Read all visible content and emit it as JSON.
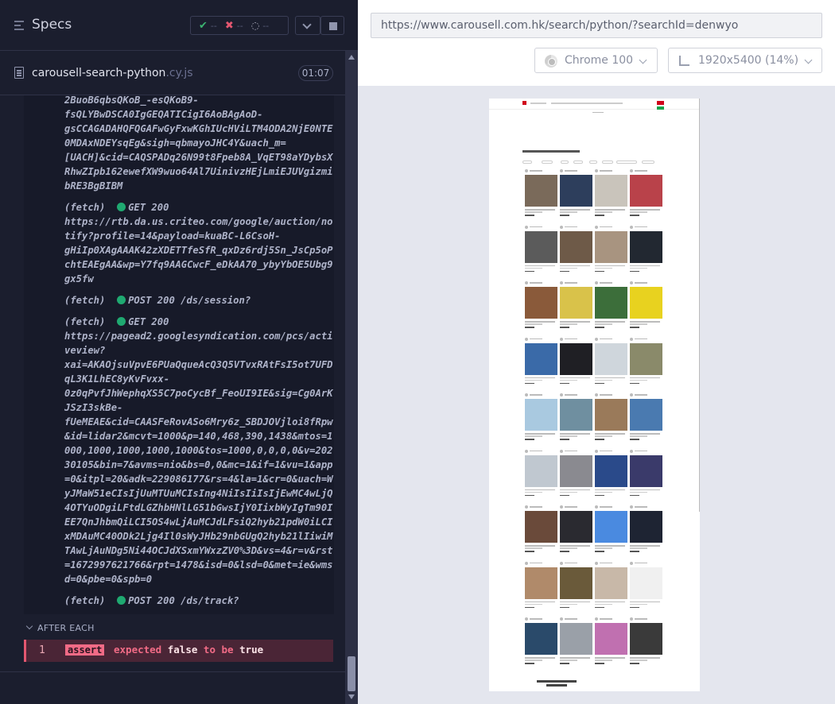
{
  "reporter": {
    "title": "Specs",
    "stats": {
      "passed": "--",
      "failed": "--",
      "pending": "--"
    },
    "file": {
      "name": "carousell-search-python",
      "ext": ".cy.js",
      "duration": "01:07"
    },
    "log_entries": [
      {
        "text": "2BuoB6qbsQKoB_-esQKoB9-\nfsQLYBwDSCA0IgGEQATICigI6AoBAgAoD-\ngsCCAGADAHQFQGAFwGyFxwKGhIUcHViLTM4ODA2NjE0NTE\n0MDAxNDEYsqEg&sigh=qbmayoJHC4Y&uach_m=\n[UACH]&cid=CAQSPADq26N99t8Fpeb8A_VqET98aYDybsX\nRhwZIpb162ewefXW9wuo64Al7UinivzHEjLmiEJUVgizmi\nbRE3BgBIBM"
      },
      {
        "prefix": "(fetch)",
        "method": "GET",
        "status": "200",
        "url": "https://rtb.da.us.criteo.com/google/auction/no\ntify?profile=14&payload=kuaBC-L6CsoH-\ngHiIp0XAgAAAK42zXDETTfeSfR_qxDz6rdj5Sn_JsCp5oP\nchtEAEgAA&wp=Y7fq9AAGCwcF_eDkAA70_ybyYbOE5Ubg9\ngx5fw"
      },
      {
        "prefix": "(fetch)",
        "method": "POST",
        "status": "200",
        "url": "/ds/session?"
      },
      {
        "prefix": "(fetch)",
        "method": "GET",
        "status": "200",
        "url": "https://pagead2.googlesyndication.com/pcs/acti\nveview?\nxai=AKAOjsuVpvE6PUaQqueAcQ3Q5VTvxRAtFsI5ot7UFD\nqL3K1LhEC8yKvFvxx-\n0z0qPvfJhWephqXS5C7poCycBf_FeoUI9IE&sig=Cg0ArK\nJSzI3skBe-\nfUeMEAE&cid=CAASFeRovASo6Mry6z_SBDJOVjloi8fRpw\n&id=lidar2&mcvt=1000&p=140,468,390,1438&mtos=1\n000,1000,1000,1000,1000&tos=1000,0,0,0,0&v=202\n30105&bin=7&avms=nio&bs=0,0&mc=1&if=1&vu=1&app\n=0&itpl=20&adk=229086177&rs=4&la=1&cr=0&uach=W\nyJMaW51eCIsIjUuMTUuMCIsIng4NiIsIiIsIjEwMC4wLjQ\n4OTYuODgiLFtdLGZhbHNlLG51bGwsIjY0IixbWyIgTm90I\nEE7QnJhbmQiLCI5OS4wLjAuMCJdLFsiQ2hyb21pdW0iLCI\nxMDAuMC40ODk2Ljg4Il0sWyJHb29nbGUgQ2hyb21lIiwiM\nTAwLjAuNDg5Ni44OCJdXSxmYWxzZV0%3D&vs=4&r=v&rst\n=1672997621766&rpt=1478&isd=0&lsd=0&met=ie&wms\nd=0&pbe=0&spb=0"
      },
      {
        "prefix": "(fetch)",
        "method": "POST",
        "status": "200",
        "url": "/ds/track?"
      }
    ],
    "hook_label": "AFTER EACH",
    "assertion": {
      "line": "1",
      "badge": "assert",
      "w1": "expected",
      "w2": "false",
      "w3": "to be",
      "w4": "true"
    }
  },
  "preview": {
    "url": "https://www.carousell.com.hk/search/python/?searchId=denwyo",
    "browser": "Chrome 100",
    "viewport": "1920x5400",
    "scale": "(14%)",
    "colors": {
      "stage_bg": "#e4e6ee",
      "brand_red": "#d0021b",
      "accent_green": "#16a34a"
    }
  }
}
